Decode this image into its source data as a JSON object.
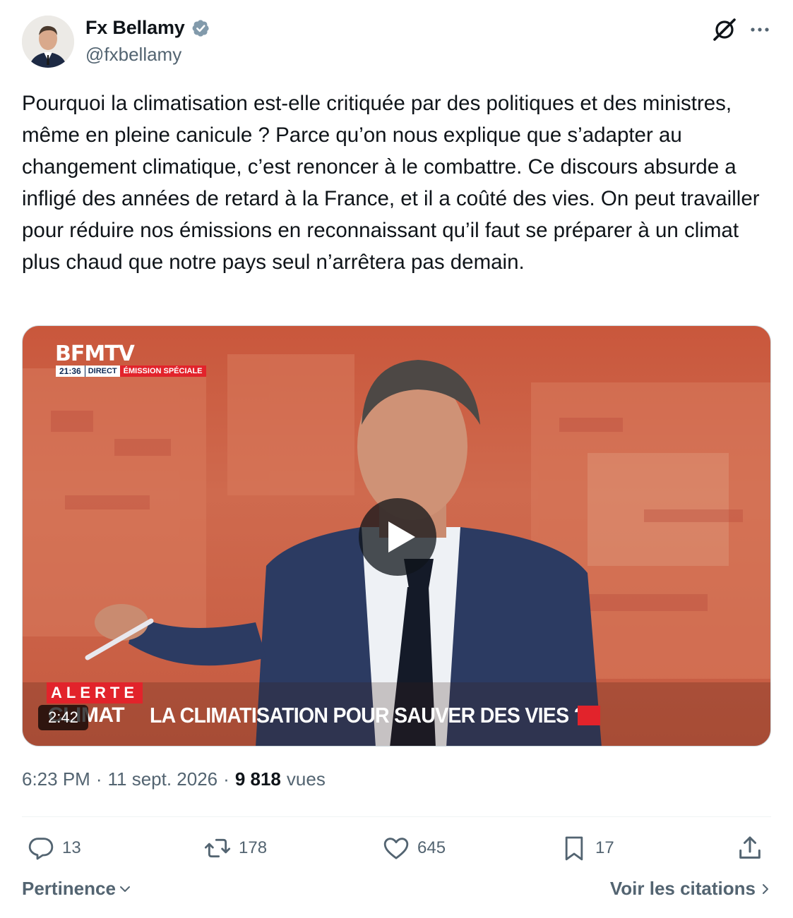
{
  "author": {
    "display_name": "Fx Bellamy",
    "handle": "@fxbellamy",
    "verified": true
  },
  "icons": {
    "verified": "verified-badge-icon",
    "grok": "grok-icon",
    "more": "more-icon",
    "play": "play-icon"
  },
  "tweet": {
    "text": "Pourquoi la climatisation est-elle critiquée par des politiques et des ministres, même en pleine canicule ? Parce qu’on nous explique que s’adapter au changement climatique, c’est renoncer à le combattre. Ce discours absurde a infligé des années de retard à la France, et il a coûté des vies. On peut travailler pour réduire nos émissions en reconnaissant qu’il faut se préparer à un climat plus chaud que notre pays seul n’arrêtera pas demain."
  },
  "video": {
    "channel_logo": "BFMTV",
    "time": "21:36",
    "direct": "DIRECT",
    "program": "ÉMISSION SPÉCIALE",
    "alert_label": "ALERTE",
    "topic": "CLIMAT",
    "headline": "LA CLIMATISATION POUR SAUVER DES VIES ?",
    "duration": "2:42"
  },
  "meta": {
    "time": "6:23 PM",
    "date": "11 sept. 2026",
    "separator": "·",
    "views_count": "9 818",
    "views_label": "vues"
  },
  "actions": {
    "replies": "13",
    "retweets": "178",
    "likes": "645",
    "bookmarks": "17"
  },
  "footer": {
    "sort_label": "Pertinence",
    "quotes_label": "Voir les citations"
  },
  "colors": {
    "text_primary": "#0f1419",
    "text_secondary": "#536471",
    "verified_badge": "#829aab",
    "bfm_red": "#e2232b"
  }
}
